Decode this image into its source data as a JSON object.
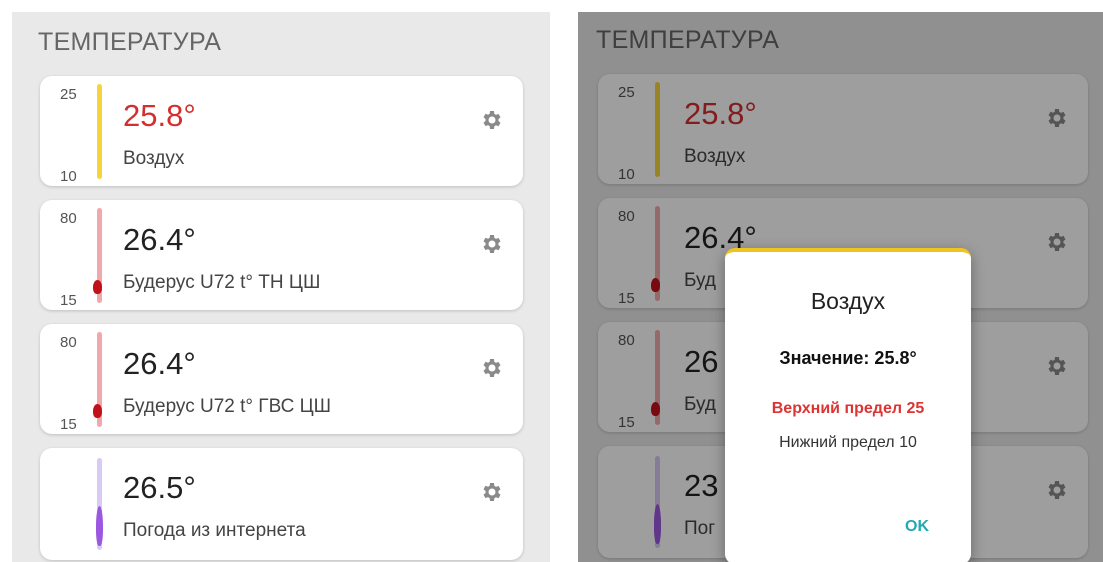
{
  "section_title": "ТЕМПЕРАТУРА",
  "sensors": [
    {
      "value": "25.8°",
      "name": "Воздух",
      "max": "25",
      "min": "10",
      "value_color": "#d32f2f",
      "bar_color": "#f9d33c",
      "bulb_color": "#f9d33c"
    },
    {
      "value": "26.4°",
      "name": "Будерус U72 t° ТН ЦШ",
      "max": "80",
      "min": "15",
      "value_color": "#222222",
      "bar_color": "#f0a8ac",
      "bulb_color": "#c1121c"
    },
    {
      "value": "26.4°",
      "name": "Будерус U72 t° ГВС ЦШ",
      "max": "80",
      "min": "15",
      "value_color": "#222222",
      "bar_color": "#f0a8ac",
      "bulb_color": "#c1121c"
    },
    {
      "value": "26.5°",
      "name": "Погода из интернета",
      "max": "",
      "min": "",
      "value_color": "#222222",
      "bar_color": "#d9c9f5",
      "bulb_color": "#9b57e0"
    }
  ],
  "right_sensors": [
    {
      "value": "25.8°",
      "name": "Воздух",
      "max": "25",
      "min": "10"
    },
    {
      "value": "26.4°",
      "name": "Буд",
      "max": "80",
      "min": "15"
    },
    {
      "value": "26",
      "name": "Буд",
      "max": "80",
      "min": "15"
    },
    {
      "value": "23",
      "name": "Пог",
      "max": "",
      "min": ""
    }
  ],
  "dialog": {
    "title": "Воздух",
    "value_text": "Значение: 25.8°",
    "upper_text": "Верхний предел 25",
    "lower_text": "Нижний предел 10",
    "ok_label": "OK",
    "accent_color": "#f0c420"
  },
  "icons": {
    "settings": "gear-icon"
  }
}
